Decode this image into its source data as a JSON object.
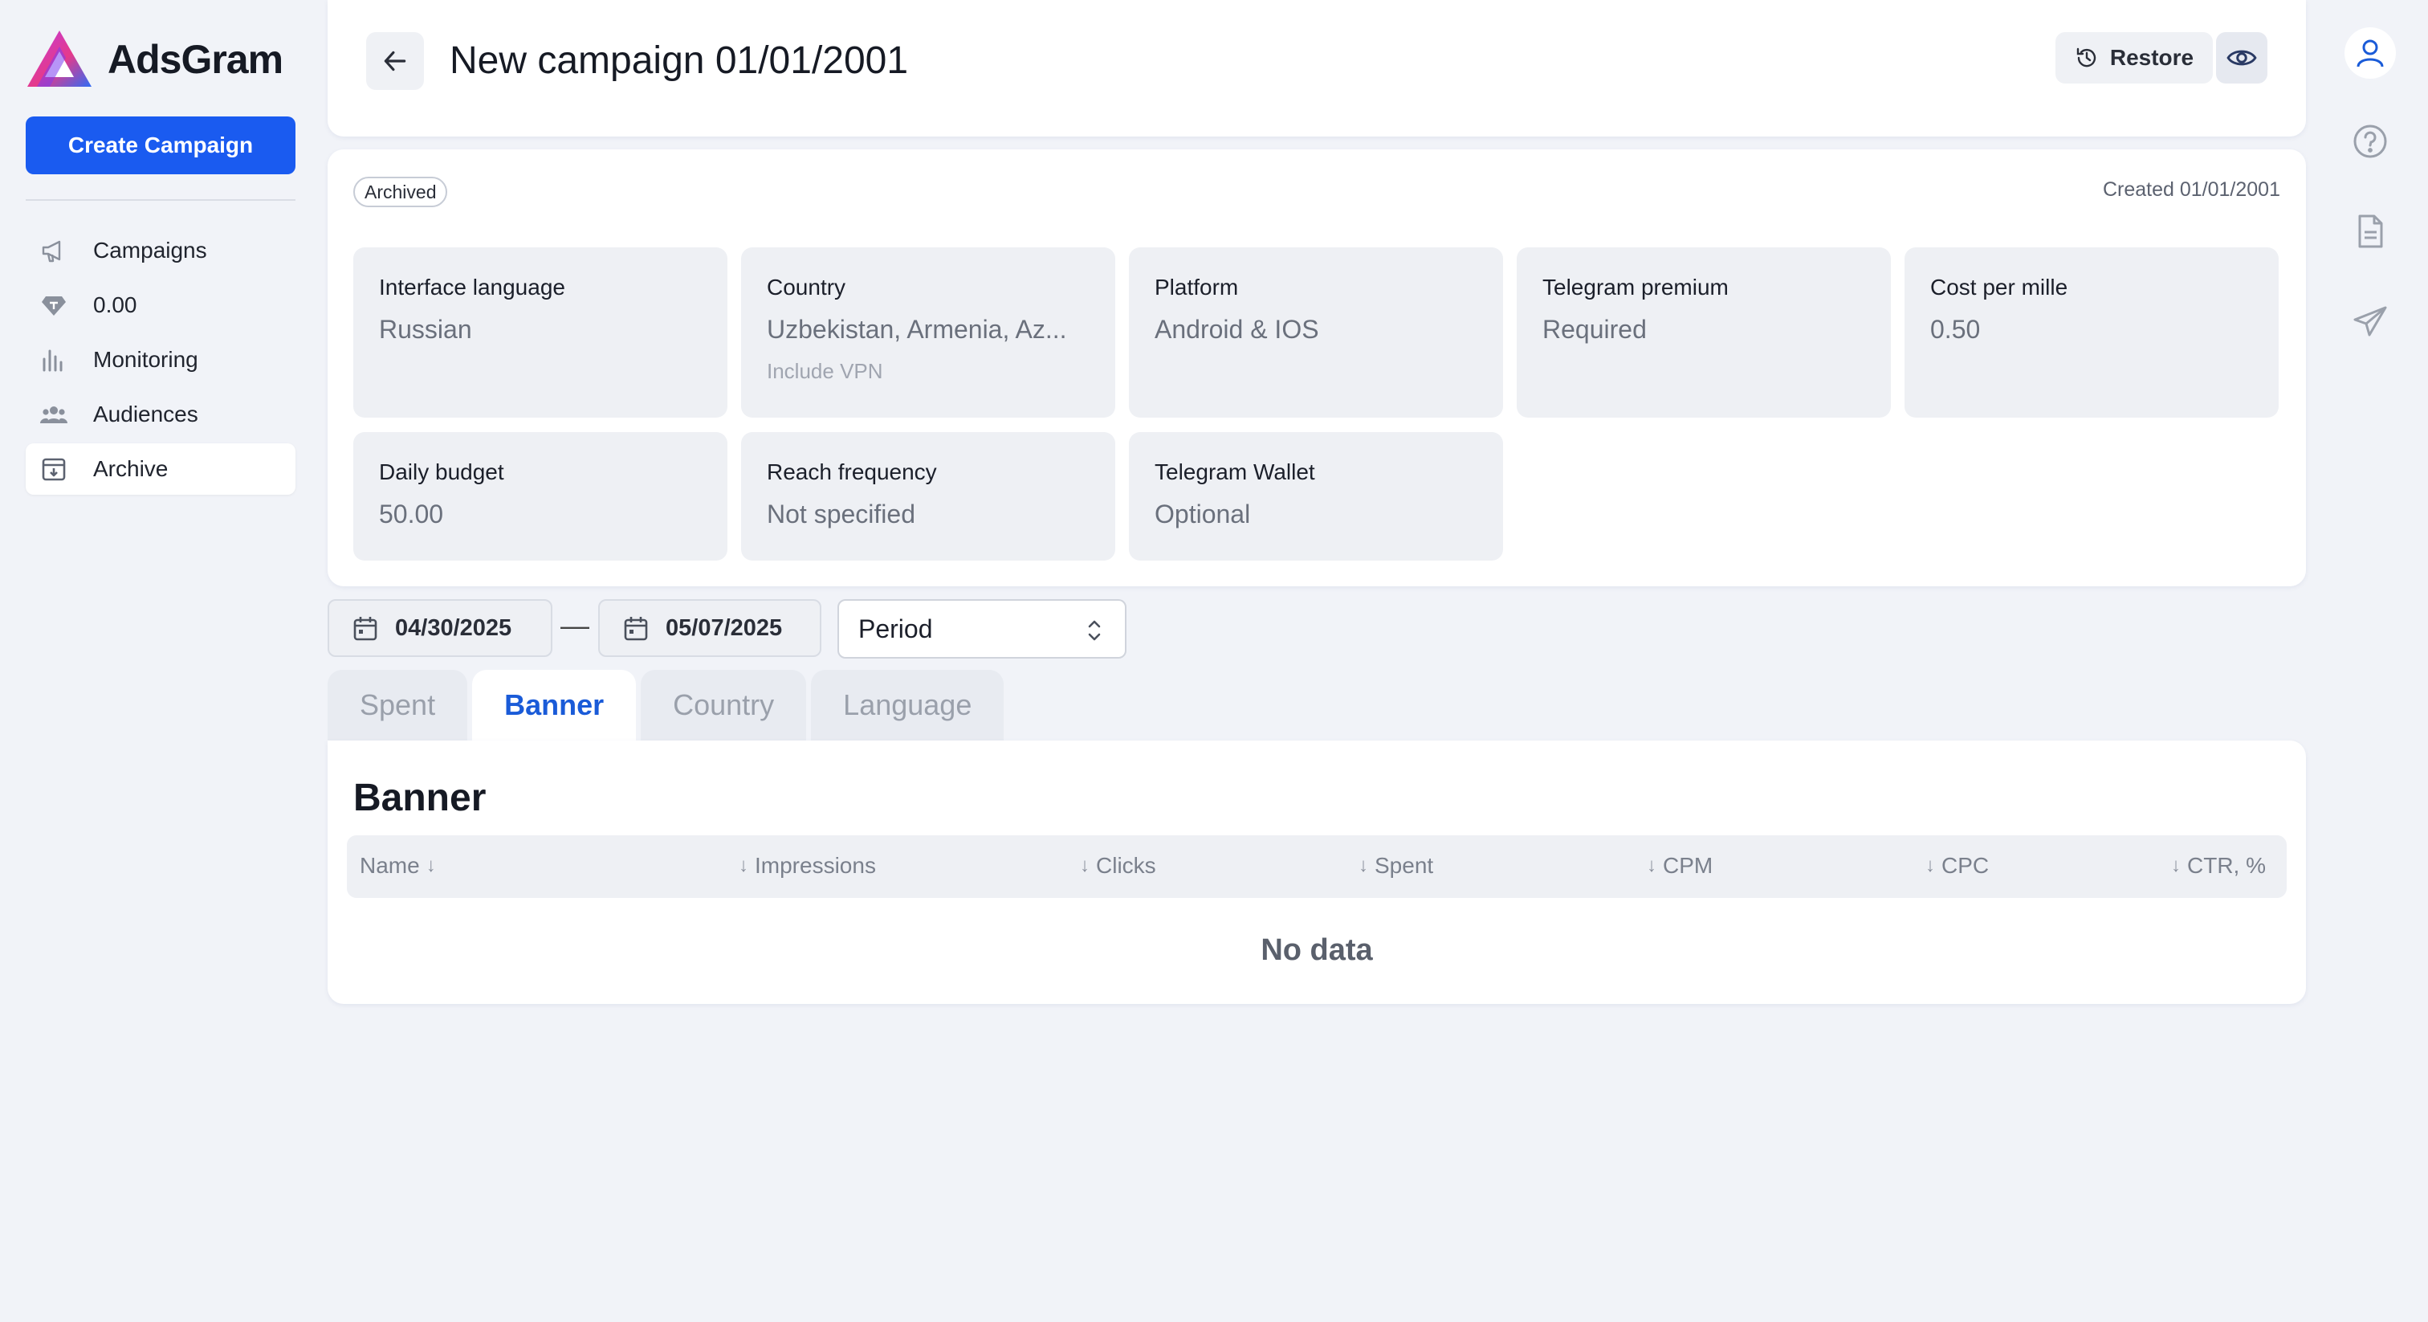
{
  "app": {
    "name": "AdsGram"
  },
  "sidebar": {
    "create_label": "Create Campaign",
    "items": [
      {
        "label": "Campaigns",
        "icon": "megaphone-icon"
      },
      {
        "label": "0.00",
        "icon": "diamond-icon"
      },
      {
        "label": "Monitoring",
        "icon": "bar-chart-icon"
      },
      {
        "label": "Audiences",
        "icon": "users-icon"
      },
      {
        "label": "Archive",
        "icon": "archive-box-icon",
        "active": true
      }
    ]
  },
  "header": {
    "title": "New campaign 01/01/2001",
    "restore_label": "Restore"
  },
  "info": {
    "status_badge": "Archived",
    "created": "Created 01/01/2001",
    "tiles": [
      {
        "label": "Interface language",
        "value": "Russian"
      },
      {
        "label": "Country",
        "value": "Uzbekistan, Armenia, Az...",
        "sub": "Include VPN"
      },
      {
        "label": "Platform",
        "value": "Android & IOS"
      },
      {
        "label": "Telegram premium",
        "value": "Required"
      },
      {
        "label": "Cost per mille",
        "value": "0.50"
      },
      {
        "label": "Daily budget",
        "value": "50.00"
      },
      {
        "label": "Reach frequency",
        "value": "Not specified"
      },
      {
        "label": "Telegram Wallet",
        "value": "Optional"
      }
    ]
  },
  "filters": {
    "date_from": "04/30/2025",
    "date_sep": "—",
    "date_to": "05/07/2025",
    "period": "Period"
  },
  "tabs": [
    {
      "label": "Spent"
    },
    {
      "label": "Banner",
      "active": true
    },
    {
      "label": "Country"
    },
    {
      "label": "Language"
    }
  ],
  "table": {
    "title": "Banner",
    "columns": [
      "Name",
      "Impressions",
      "Clicks",
      "Spent",
      "CPM",
      "CPC",
      "CTR, %"
    ],
    "sort_arrow": "↓",
    "empty": "No data"
  },
  "colors": {
    "accent": "#1a5bf0",
    "background": "#f1f3f8"
  }
}
